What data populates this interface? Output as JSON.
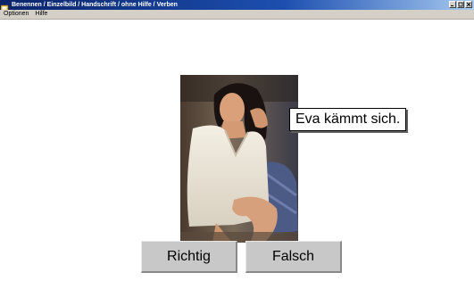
{
  "window": {
    "title": "Benennen / Einzelbild / Handschrift / ohne Hilfe / Verben",
    "icon": "app-icon",
    "controls": [
      "minimize-icon",
      "maximize-icon",
      "close-icon"
    ]
  },
  "menu": {
    "items": [
      {
        "label": "Optionen"
      },
      {
        "label": "Hilfe"
      }
    ]
  },
  "exercise": {
    "image": "woman-combing-hair-photo",
    "caption": "Eva kämmt sich.",
    "buttons": {
      "correct_label": "Richtig",
      "wrong_label": "Falsch"
    }
  },
  "colors": {
    "titlebar_start": "#0a246a",
    "titlebar_end": "#a6caf0",
    "menubar": "#d4d0c8",
    "button_face": "#c8c8c8",
    "background": "#ffffff"
  }
}
